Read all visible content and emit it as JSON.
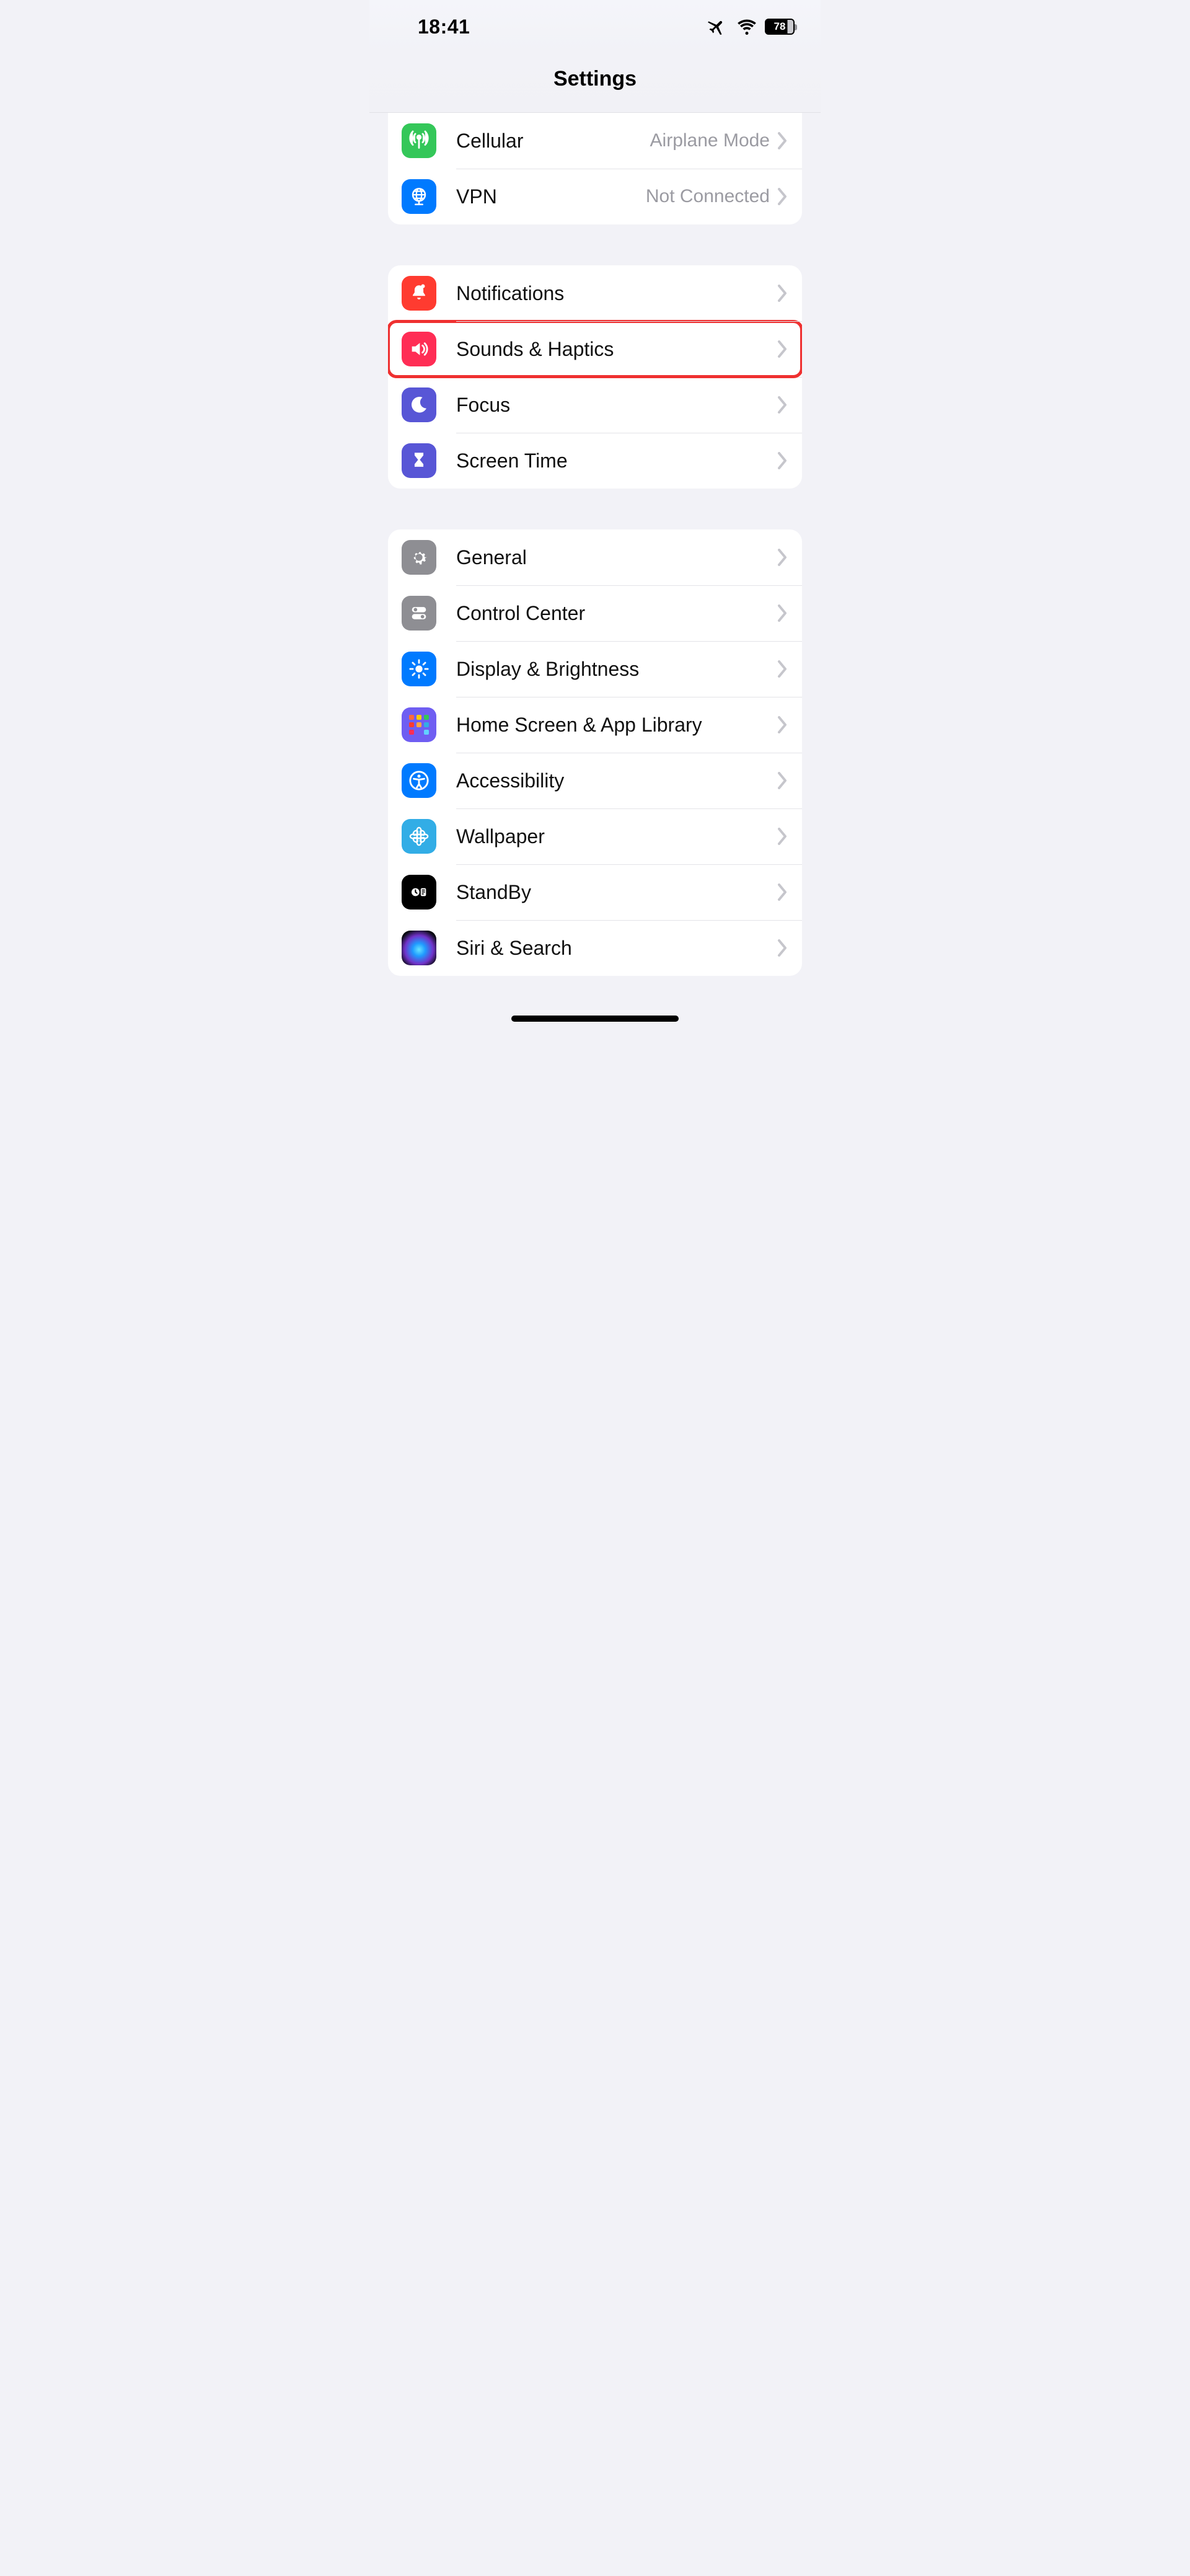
{
  "statusbar": {
    "time": "18:41",
    "battery_percent": "78"
  },
  "header": {
    "title": "Settings"
  },
  "groups": [
    {
      "id": "network",
      "first": true,
      "rows": [
        {
          "id": "cellular",
          "label": "Cellular",
          "detail": "Airplane Mode",
          "icon": "antenna-icon",
          "color": "bg-green"
        },
        {
          "id": "vpn",
          "label": "VPN",
          "detail": "Not Connected",
          "icon": "globe-icon",
          "color": "bg-blue"
        }
      ]
    },
    {
      "id": "notifications",
      "rows": [
        {
          "id": "notifications",
          "label": "Notifications",
          "icon": "bell-icon",
          "color": "bg-red"
        },
        {
          "id": "sounds",
          "label": "Sounds & Haptics",
          "icon": "speaker-icon",
          "color": "bg-pink",
          "highlight": true
        },
        {
          "id": "focus",
          "label": "Focus",
          "icon": "moon-icon",
          "color": "bg-indigo"
        },
        {
          "id": "screentime",
          "label": "Screen Time",
          "icon": "hourglass-icon",
          "color": "bg-indigo"
        }
      ]
    },
    {
      "id": "general",
      "rows": [
        {
          "id": "general",
          "label": "General",
          "icon": "gear-icon",
          "color": "bg-grey"
        },
        {
          "id": "controlcenter",
          "label": "Control Center",
          "icon": "switches-icon",
          "color": "bg-grey"
        },
        {
          "id": "display",
          "label": "Display & Brightness",
          "icon": "sun-icon",
          "color": "bg-blue"
        },
        {
          "id": "homescreen",
          "label": "Home Screen & App Library",
          "icon": "apps-grid-icon",
          "color": "bg-purple"
        },
        {
          "id": "accessibility",
          "label": "Accessibility",
          "icon": "accessibility-icon",
          "color": "bg-blue"
        },
        {
          "id": "wallpaper",
          "label": "Wallpaper",
          "icon": "flower-icon",
          "color": "bg-sky"
        },
        {
          "id": "standby",
          "label": "StandBy",
          "icon": "clock-card-icon",
          "color": "bg-black"
        },
        {
          "id": "siri",
          "label": "Siri & Search",
          "icon": "siri-icon",
          "color": "bg-siri"
        }
      ]
    }
  ]
}
